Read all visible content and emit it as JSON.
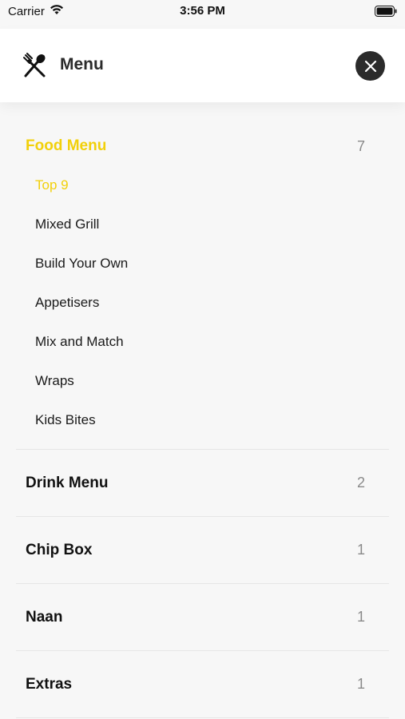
{
  "status": {
    "carrier": "Carrier",
    "time": "3:56 PM"
  },
  "header": {
    "title": "Menu",
    "icon": "utensils-icon",
    "close_icon": "close-icon"
  },
  "colors": {
    "accent": "#f2d00a",
    "dark": "#2b2b2b",
    "muted": "#8a8a8a"
  },
  "categories": [
    {
      "label": "Food Menu",
      "count": "7",
      "active": true,
      "items": [
        {
          "label": "Top 9",
          "active": true
        },
        {
          "label": "Mixed Grill",
          "active": false
        },
        {
          "label": "Build Your Own",
          "active": false
        },
        {
          "label": "Appetisers",
          "active": false
        },
        {
          "label": "Mix and Match",
          "active": false
        },
        {
          "label": "Wraps",
          "active": false
        },
        {
          "label": "Kids Bites",
          "active": false
        }
      ]
    },
    {
      "label": "Drink Menu",
      "count": "2",
      "active": false
    },
    {
      "label": "Chip Box",
      "count": "1",
      "active": false
    },
    {
      "label": "Naan",
      "count": "1",
      "active": false
    },
    {
      "label": "Extras",
      "count": "1",
      "active": false
    }
  ]
}
